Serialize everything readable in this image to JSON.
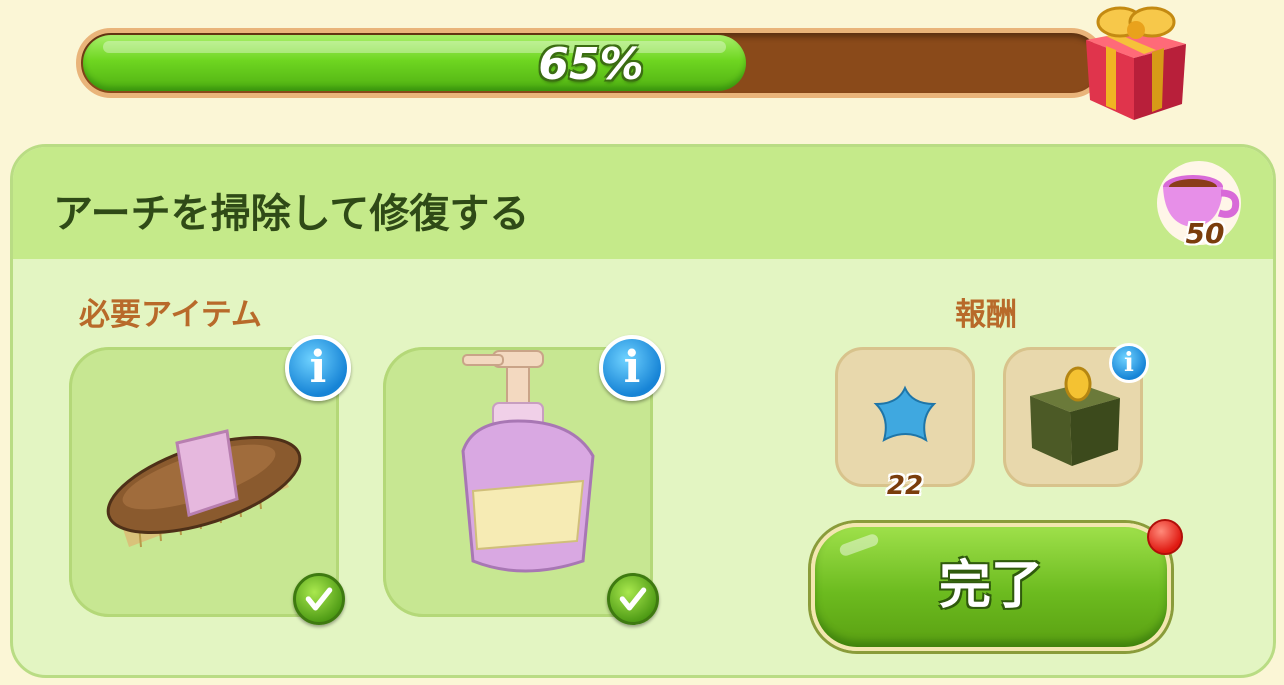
{
  "progress": {
    "percent_label": "65%",
    "fraction": 0.65,
    "fill_color": "#6fd621",
    "track_color": "#8a4a1a"
  },
  "gift": {
    "icon": "gift-box-icon"
  },
  "task": {
    "title": "アーチを掃除して修復する",
    "energy_cost": "50",
    "energy_icon": "teacup-icon"
  },
  "required": {
    "label": "必要アイテム",
    "items": [
      {
        "icon": "brush-icon",
        "status": "complete"
      },
      {
        "icon": "soap-bottle-icon",
        "status": "complete"
      }
    ]
  },
  "rewards": {
    "label": "報酬",
    "items": [
      {
        "icon": "blue-star-icon",
        "count": "22"
      },
      {
        "icon": "coin-bank-box-icon"
      }
    ]
  },
  "action": {
    "complete_label": "完了",
    "accent": "#6cbb1f"
  }
}
